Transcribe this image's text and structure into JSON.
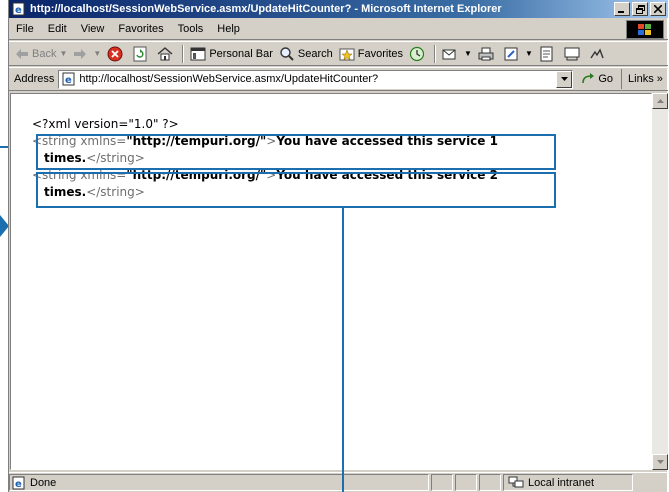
{
  "window": {
    "title": "http://localhost/SessionWebService.asmx/UpdateHitCounter? - Microsoft Internet Explorer"
  },
  "menu": [
    "File",
    "Edit",
    "View",
    "Favorites",
    "Tools",
    "Help"
  ],
  "toolbar": {
    "back_label": "Back",
    "personal_bar_label": "Personal Bar",
    "search_label": "Search",
    "favorites_label": "Favorites"
  },
  "address": {
    "label": "Address",
    "url": "http://localhost/SessionWebService.asmx/UpdateHitCounter?",
    "go_label": "Go",
    "links_label": "Links »"
  },
  "document": {
    "xml_decl": "<?xml version=\"1.0\" ?>",
    "responses": [
      {
        "open_tag_start": "<string xmlns=",
        "namespace": "\"http://tempuri.org/\"",
        "open_tag_end": ">",
        "message_line1": "You have accessed this service 1",
        "message_line2": "times.",
        "close_tag": "</string>"
      },
      {
        "open_tag_start": "<string xmlns=",
        "namespace": "\"http://tempuri.org/\"",
        "open_tag_end": ">",
        "message_line1": "You have accessed this service 2",
        "message_line2": "times.",
        "close_tag": "</string>"
      }
    ]
  },
  "status": {
    "text": "Done",
    "zone": "Local intranet"
  },
  "colors": {
    "callout": "#1c6fae",
    "title_gradient_start": "#0a246a",
    "chrome": "#d4d0c8"
  }
}
